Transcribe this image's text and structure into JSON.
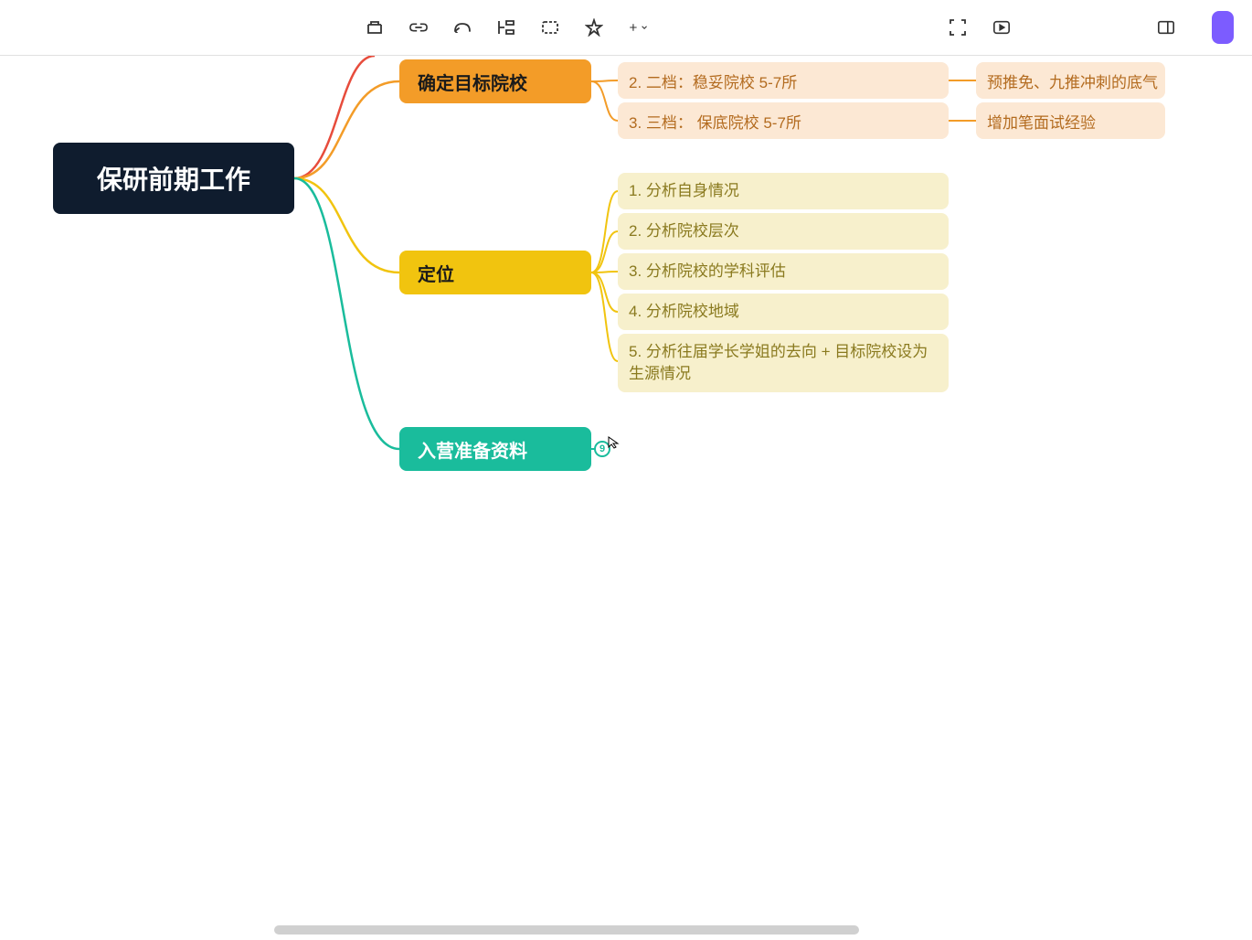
{
  "root": "保研前期工作",
  "branch1": "确定目标院校",
  "branch1_leaf2": "2. 二档：稳妥院校 5-7所",
  "branch1_leaf3": "3. 三档： 保底院校 5-7所",
  "branch1_leaf2_sub": "预推免、九推冲刺的底气",
  "branch1_leaf3_sub": "增加笔面试经验",
  "branch2": "定位",
  "branch2_leaf1": "1. 分析自身情况",
  "branch2_leaf2": "2. 分析院校层次",
  "branch2_leaf3": "3. 分析院校的学科评估",
  "branch2_leaf4": "4. 分析院校地域",
  "branch2_leaf5": "5. 分析往届学长学姐的去向 + 目标院校设为生源情况",
  "branch3": "入营准备资料",
  "collapse_count": "9"
}
